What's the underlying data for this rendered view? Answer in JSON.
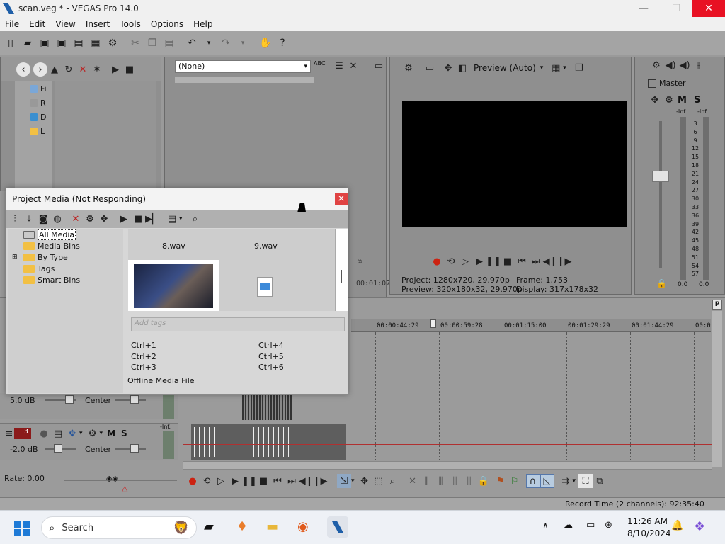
{
  "window": {
    "title": "scan.veg * - VEGAS Pro 14.0",
    "min": "—",
    "max": "☐",
    "close": "✕"
  },
  "menu": [
    "File",
    "Edit",
    "View",
    "Insert",
    "Tools",
    "Options",
    "Help"
  ],
  "trimmer": {
    "select_value": "(None)",
    "abc": "ABC",
    "timecode": "00:01:07"
  },
  "explorer": {
    "items": [
      "Fi",
      "R",
      "D",
      "L"
    ]
  },
  "preview": {
    "mode": "Preview (Auto)",
    "project_label": "Project:",
    "project_value": "1280x720, 29.970p",
    "preview_label": "Preview:",
    "preview_value": "320x180x32, 29.970p",
    "frame_label": "Frame:",
    "frame_value": "1,753",
    "display_label": "Display:",
    "display_value": "317x178x32"
  },
  "master": {
    "label": "Master",
    "m": "M",
    "s": "S",
    "inf_left": "-Inf.",
    "inf_right": "-Inf.",
    "scale": [
      "3",
      "6",
      "9",
      "12",
      "15",
      "18",
      "21",
      "24",
      "27",
      "30",
      "33",
      "36",
      "39",
      "42",
      "45",
      "48",
      "51",
      "54",
      "57"
    ],
    "left_value": "0.0",
    "right_value": "0.0"
  },
  "project_media": {
    "title": "Project Media (Not Responding)",
    "close": "×",
    "tree": [
      "All Media",
      "Media Bins",
      "By Type",
      "Tags",
      "Smart Bins"
    ],
    "files": [
      "8.wav",
      "9.wav"
    ],
    "add_tags_placeholder": "Add tags",
    "shortcuts": [
      "Ctrl+1",
      "Ctrl+2",
      "Ctrl+3",
      "Ctrl+4",
      "Ctrl+5",
      "Ctrl+6"
    ],
    "status": "Offline Media File"
  },
  "timeline": {
    "ruler": [
      "00:00:44:29",
      "00:00:59:28",
      "00:01:15:00",
      "00:01:29:29",
      "00:01:44:29",
      "00:0"
    ],
    "track1": {
      "volume": "5.0 dB",
      "pan": "Center"
    },
    "track2": {
      "number": "3",
      "m": "M",
      "s": "S",
      "volume": "-2.0 dB",
      "pan": "Center",
      "inf": "-Inf."
    },
    "rate": "Rate: 0.00",
    "p_button": "P"
  },
  "status": {
    "record_time": "Record Time (2 channels): 92:35:40"
  },
  "taskbar": {
    "search": "Search",
    "time": "11:26 AM",
    "date": "8/10/2024"
  }
}
